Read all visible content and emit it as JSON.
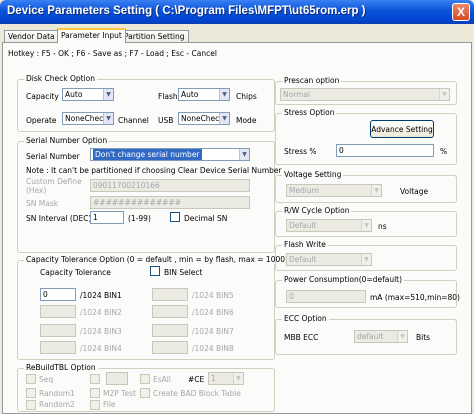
{
  "window": {
    "title": "Device Parameters Setting ( C:\\Program Files\\MFPT\\ut65rom.erp )",
    "close_glyph": "X"
  },
  "tabs": [
    {
      "label": "Vendor Data"
    },
    {
      "label": "Parameter Input"
    },
    {
      "label": "Partition Setting"
    }
  ],
  "hotkey": "Hotkey : F5 - OK ; F6 - Save as ; F7 - Load ; Esc - Cancel",
  "disk_check": {
    "legend": "Disk Check Option",
    "capacity_label": "Capacity",
    "capacity_value": "Auto",
    "flash_label": "Flash",
    "flash_value": "Auto",
    "chips_label": "Chips",
    "operate_label": "Operate",
    "operate_value": "NoneCheck",
    "channel_label": "Channel",
    "usb_label": "USB",
    "usb_value": "NoneCheck",
    "mode_label": "Mode"
  },
  "serial": {
    "legend": "Serial Number Option",
    "sn_label": "Serial Number",
    "sn_value": "Don't change serial number",
    "note": "Note : It can't be partitioned if choosing Clear Device Serial Number",
    "custom_label": "Custom Define (Hex)",
    "custom_value": "09011700210166",
    "mask_label": "SN Mask",
    "mask_value": "##############",
    "interval_label": "SN Interval (DEC)",
    "interval_value": "1",
    "interval_range": "(1-99)",
    "decimal_label": "Decimal SN"
  },
  "capacity_tol": {
    "legend": "Capacity Tolerance Option (0 = default , min = by flash, max = 1000)",
    "header": "Capacity Tolerance",
    "bin_select": "BIN Select",
    "bins": [
      {
        "value": "0",
        "label": "/1024 BIN1"
      },
      {
        "value": "",
        "label": "/1024 BIN2"
      },
      {
        "value": "",
        "label": "/1024 BIN3"
      },
      {
        "value": "",
        "label": "/1024 BIN4"
      },
      {
        "value": "",
        "label": "/1024 BIN5"
      },
      {
        "value": "",
        "label": "/1024 BIN6"
      },
      {
        "value": "",
        "label": "/1024 BIN7"
      },
      {
        "value": "",
        "label": "/1024 BIN8"
      }
    ]
  },
  "rebuild": {
    "legend": "ReBuildTBL Option",
    "seq": "Seq",
    "random1": "Random1",
    "random2": "Random2",
    "m2p": "M2P Test",
    "file": "File",
    "esall": "EsAll",
    "ce_label": "#CE",
    "ce_value": "1",
    "create_bad": "Create BAD Block Table"
  },
  "prescan": {
    "legend": "Prescan option",
    "value": "Normal"
  },
  "stress": {
    "legend": "Stress Option",
    "advance_button": "Advance Setting",
    "label": "Stress %",
    "value": "0",
    "unit": "%"
  },
  "voltage": {
    "legend": "Voltage Setting",
    "value": "Medium",
    "label": "Voltage"
  },
  "rw_cycle": {
    "legend": "R/W Cycle Option",
    "value": "Default",
    "unit": "ns"
  },
  "flash_write": {
    "legend": "Flash Write",
    "value": "Default"
  },
  "power": {
    "legend": "Power Consumption(0=default)",
    "value": "0",
    "unit": "mA (max=510,min=80)"
  },
  "ecc": {
    "legend": "ECC Option",
    "label": "MBB ECC",
    "value": "default",
    "unit": "Bits"
  }
}
